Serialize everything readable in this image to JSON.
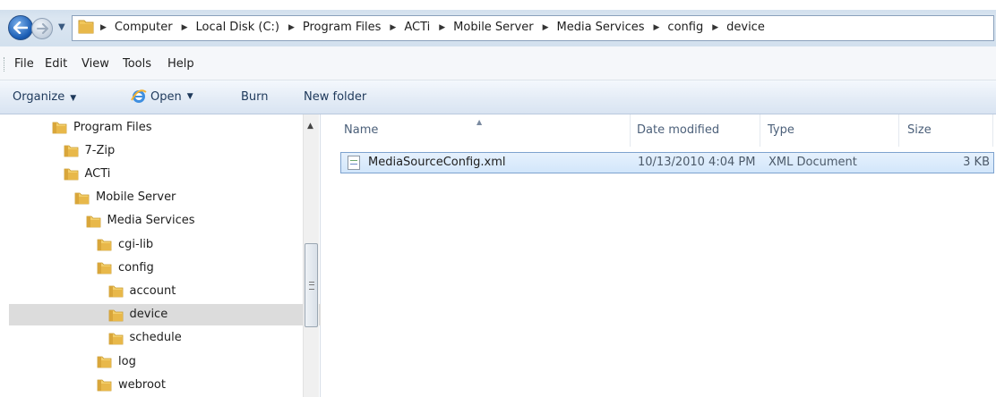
{
  "address": {
    "crumbs": [
      "Computer",
      "Local Disk (C:)",
      "Program Files",
      "ACTi",
      "Mobile Server",
      "Media Services",
      "config",
      "device"
    ]
  },
  "menu": [
    "File",
    "Edit",
    "View",
    "Tools",
    "Help"
  ],
  "toolbar": {
    "organize": "Organize",
    "open": "Open",
    "burn": "Burn",
    "new_folder": "New folder"
  },
  "tree": [
    {
      "label": "Program Files",
      "indent": 0
    },
    {
      "label": "7-Zip",
      "indent": 1
    },
    {
      "label": "ACTi",
      "indent": 1
    },
    {
      "label": "Mobile Server",
      "indent": 2
    },
    {
      "label": "Media Services",
      "indent": 3
    },
    {
      "label": "cgi-lib",
      "indent": 4
    },
    {
      "label": "config",
      "indent": 4
    },
    {
      "label": "account",
      "indent": 5
    },
    {
      "label": "device",
      "indent": 5,
      "selected": true
    },
    {
      "label": "schedule",
      "indent": 5
    },
    {
      "label": "log",
      "indent": 4
    },
    {
      "label": "webroot",
      "indent": 4
    }
  ],
  "columns": {
    "name": "Name",
    "date": "Date modified",
    "type": "Type",
    "size": "Size"
  },
  "files": [
    {
      "name": "MediaSourceConfig.xml",
      "date": "10/13/2010 4:04 PM",
      "type": "XML Document",
      "size": "3 KB"
    }
  ],
  "colors": {
    "selection": "#dcdcdc",
    "file_selection_border": "#7da2ce",
    "folder": "#e8b84a"
  }
}
